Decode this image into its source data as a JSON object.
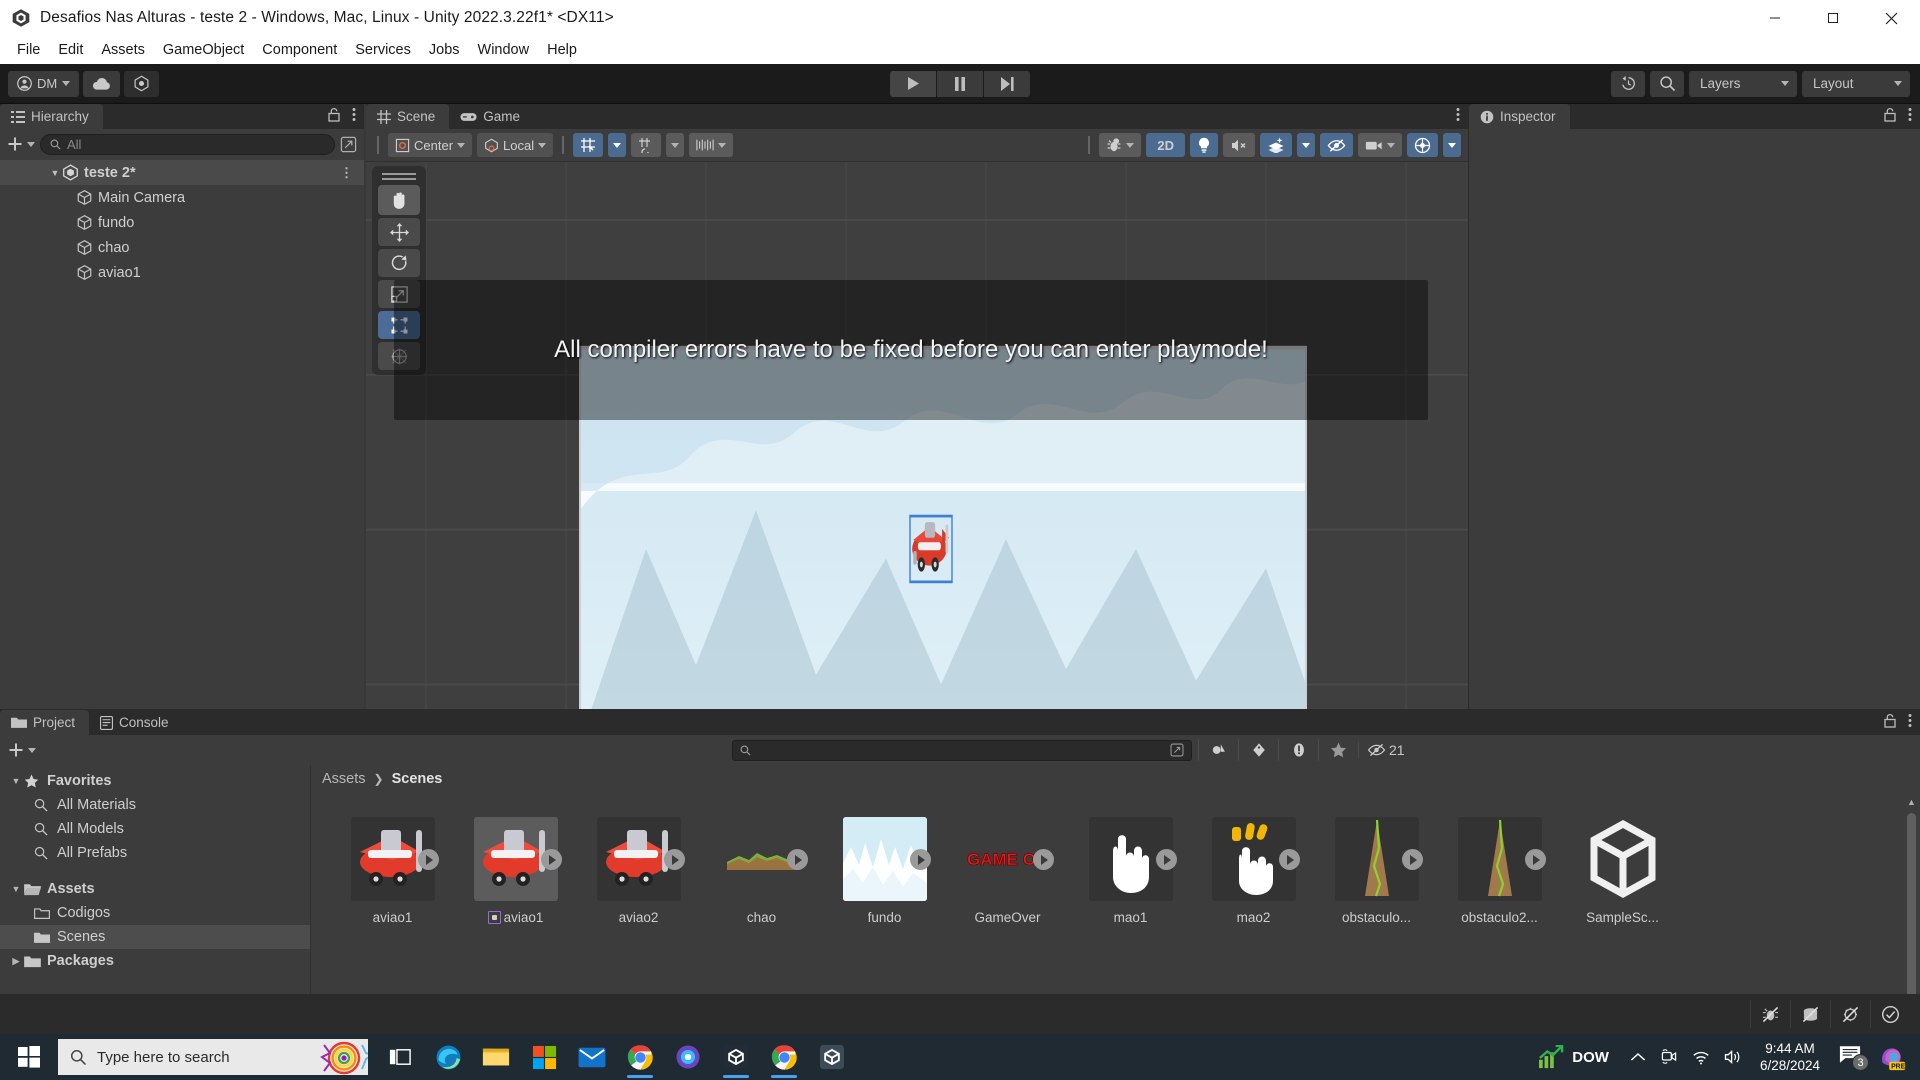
{
  "window": {
    "title": "Desafios Nas Alturas - teste 2 - Windows, Mac, Linux - Unity 2022.3.22f1* <DX11>",
    "minimize_label": "Minimize",
    "maximize_label": "Restore",
    "close_label": "Close"
  },
  "menubar": [
    "File",
    "Edit",
    "Assets",
    "GameObject",
    "Component",
    "Services",
    "Jobs",
    "Window",
    "Help"
  ],
  "toolbar": {
    "account_label": "DM",
    "cloud_label": "cloud-icon",
    "services_label": "unity-services-icon",
    "play_label": "Play",
    "pause_label": "Pause",
    "step_label": "Step",
    "undo_history_label": "undo-history-icon",
    "search_label": "search-icon",
    "layers_label": "Layers",
    "layout_label": "Layout"
  },
  "hierarchy": {
    "tab_label": "Hierarchy",
    "add_label": "+",
    "search_value": "All",
    "scene_name": "teste 2*",
    "objects": [
      "Main Camera",
      "fundo",
      "chao",
      "aviao1"
    ]
  },
  "scene": {
    "tabs": [
      {
        "label": "Scene",
        "active": true
      },
      {
        "label": "Game",
        "active": false
      }
    ],
    "pivot_label": "Center",
    "space_label": "Local",
    "grid_label": "grid-snapping-icon",
    "snap_increment_label": "snap-increment-icon",
    "grid_size_label": "grid-size-icon",
    "debug_label": "debug-draw-icon",
    "view_2d_label": "2D",
    "lighting_label": "scene-lighting-icon",
    "audio_label": "scene-audio-icon",
    "fx_label": "scene-fx-icon",
    "visibility_label": "scene-visibility-icon",
    "camera_label": "scene-camera-icon",
    "gizmos_label": "gizmos-icon",
    "tools": [
      "hand-tool",
      "move-tool",
      "rotate-tool",
      "scale-tool",
      "rect-tool",
      "transform-tool"
    ],
    "active_tool": "rect-tool",
    "notification": "All compiler errors have to be fixed before you can enter playmode!"
  },
  "inspector": {
    "tab_label": "Inspector"
  },
  "project": {
    "tabs": [
      {
        "label": "Project",
        "active": true
      },
      {
        "label": "Console",
        "active": false
      }
    ],
    "add_label": "+",
    "search_placeholder": "",
    "search_value": "",
    "filter_icons": [
      "filter-by-type-icon",
      "filter-by-label-icon",
      "warning-icon",
      "favorite-icon"
    ],
    "hidden_items_count": "21",
    "tree": [
      {
        "label": "Favorites",
        "depth": 0,
        "icon": "star-icon",
        "expanded": true,
        "bold": true
      },
      {
        "label": "All Materials",
        "depth": 1,
        "icon": "search-icon",
        "bold": false
      },
      {
        "label": "All Models",
        "depth": 1,
        "icon": "search-icon",
        "bold": false
      },
      {
        "label": "All Prefabs",
        "depth": 1,
        "icon": "search-icon",
        "bold": false
      },
      {
        "label": "Assets",
        "depth": 0,
        "icon": "folder-open-icon",
        "expanded": true,
        "bold": true
      },
      {
        "label": "Codigos",
        "depth": 1,
        "icon": "folder-icon",
        "bold": false
      },
      {
        "label": "Scenes",
        "depth": 1,
        "icon": "folder-icon",
        "bold": false,
        "selected": true
      },
      {
        "label": "Packages",
        "depth": 0,
        "icon": "folder-icon",
        "expanded": false,
        "bold": true
      }
    ],
    "breadcrumb": [
      "Assets",
      "Scenes"
    ],
    "assets": [
      {
        "label": "aviao1",
        "kind": "plane",
        "prefab": false,
        "selected": false
      },
      {
        "label": "aviao1",
        "kind": "plane",
        "prefab": true,
        "selected": true
      },
      {
        "label": "aviao2",
        "kind": "plane",
        "prefab": false,
        "selected": false
      },
      {
        "label": "chao",
        "kind": "ground",
        "prefab": false,
        "selected": false
      },
      {
        "label": "fundo",
        "kind": "background",
        "prefab": false,
        "selected": false
      },
      {
        "label": "GameOver",
        "kind": "gameover",
        "prefab": false,
        "selected": false
      },
      {
        "label": "mao1",
        "kind": "hand1",
        "prefab": false,
        "selected": false
      },
      {
        "label": "mao2",
        "kind": "hand2",
        "prefab": false,
        "selected": false
      },
      {
        "label": "obstaculo...",
        "kind": "obstacle",
        "prefab": false,
        "selected": false
      },
      {
        "label": "obstaculo2...",
        "kind": "obstacle",
        "prefab": false,
        "selected": false
      },
      {
        "label": "SampleSc...",
        "kind": "unity-scene",
        "prefab": false,
        "selected": false
      }
    ]
  },
  "statusbar": {
    "icons": [
      "code-optimization-icon",
      "cache-server-icon",
      "auto-generate-lighting-icon",
      "status-ok-icon"
    ]
  },
  "taskbar": {
    "start_label": "Start",
    "search_placeholder": "Type here to search",
    "task_view_label": "task-view-icon",
    "apps": [
      "edge-icon",
      "file-explorer-icon",
      "microsoft-store-icon",
      "mail-icon",
      "chrome-icon",
      "edge-dev-icon",
      "unity-hub-icon",
      "chrome-icon",
      "unity-icon"
    ],
    "stock_label": "DOW",
    "tray_icons": [
      "show-hidden-icons-icon",
      "meet-now-icon",
      "network-icon",
      "volume-icon"
    ],
    "time": "9:44 AM",
    "date": "6/28/2024",
    "notification_count": "3",
    "copilot_label": "PRE"
  },
  "colors": {
    "unity_bg": "#3c3c3c",
    "toolbar_bg": "#1b1b1b",
    "accent_blue": "#4b6b91",
    "selection": "#4d4d4d",
    "taskbar": "#1f2a33"
  }
}
